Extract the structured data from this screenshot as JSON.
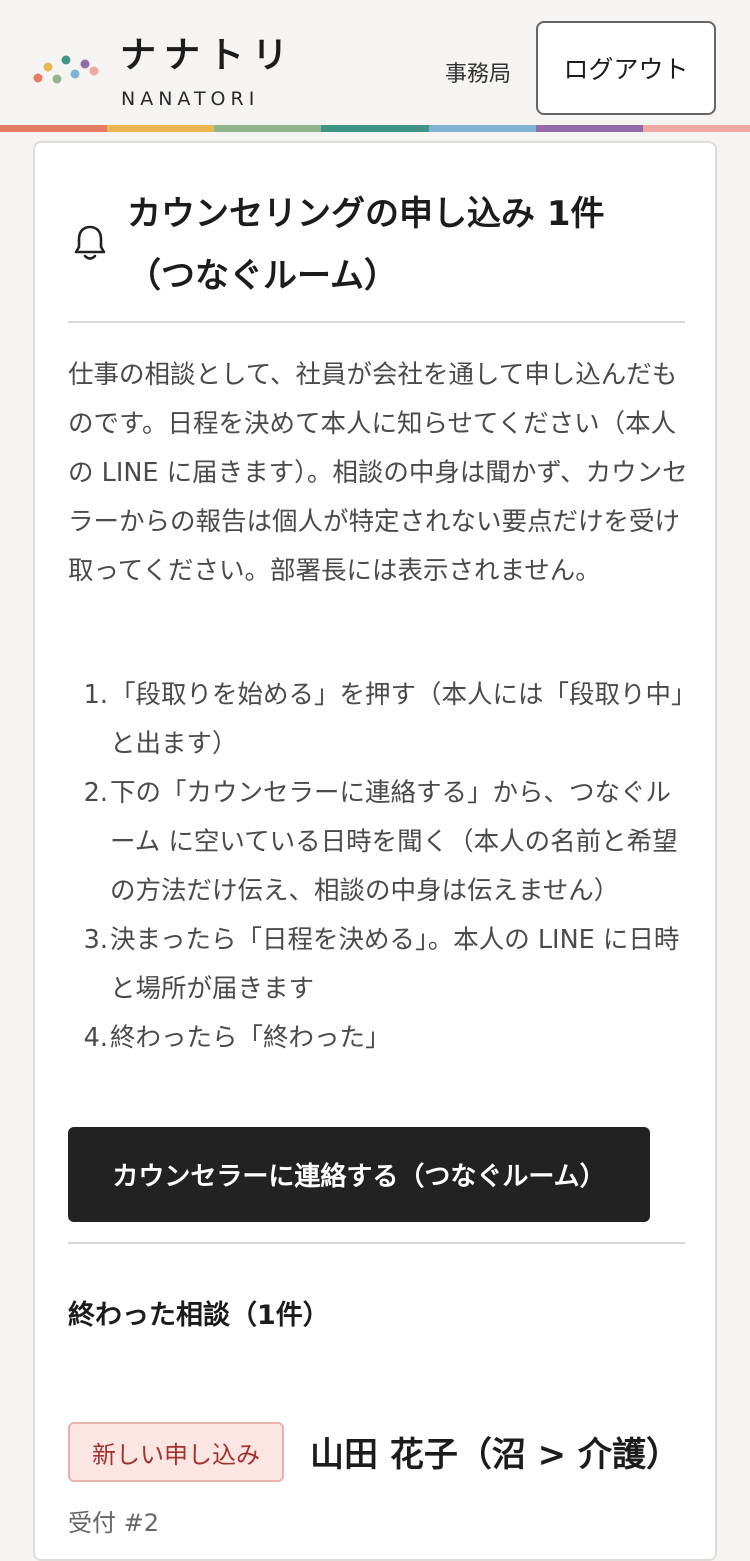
{
  "header": {
    "brand_name": "ナナトリ",
    "brand_sub": "NANATORI",
    "office_label": "事務局",
    "logout_label": "ログアウト"
  },
  "colors": {
    "strip": [
      "#e57c63",
      "#e9b64f",
      "#90b48d",
      "#3e9586",
      "#7fb3d3",
      "#946aa8",
      "#f0a9a2"
    ],
    "logo_dots": [
      "#e57c63",
      "#e9b64f",
      "#90b48d",
      "#3e9586",
      "#7fb3d3",
      "#946aa8",
      "#f0a9a2"
    ],
    "badge_bg": "#fce6e4",
    "badge_text": "#a3322d",
    "button_bg": "#222222"
  },
  "card": {
    "title_line1": "カウンセリングの申し込み 1件",
    "title_line2": "（つなぐルーム）",
    "description": "仕事の相談として、社員が会社を通して申し込んだものです。日程を決めて本人に知らせてください（本人の LINE に届きます）。相談の中身は聞かず、カウンセラーからの報告は個人が特定されない要点だけを受け取ってください。部署長には表示されません。",
    "steps": [
      {
        "num": "1.",
        "text": "「段取りを始める」を押す（本人には「段取り中」と出ます）"
      },
      {
        "num": "2.",
        "text": "下の「カウンセラーに連絡する」から、つなぐルーム に空いている日時を聞く（本人の名前と希望の方法だけ伝え、相談の中身は伝えません）"
      },
      {
        "num": "3.",
        "text": "決まったら「日程を決める」。本人の LINE に日時と場所が届きます"
      },
      {
        "num": "4.",
        "text": "終わったら「終わった」"
      }
    ],
    "contact_button": "カウンセラーに連絡する（つなぐルーム）",
    "done_heading": "終わった相談（1件）",
    "entry": {
      "status": "新しい申し込み",
      "name": "山田 花子（沼 > 介護）",
      "receipt": "受付 #2"
    }
  }
}
